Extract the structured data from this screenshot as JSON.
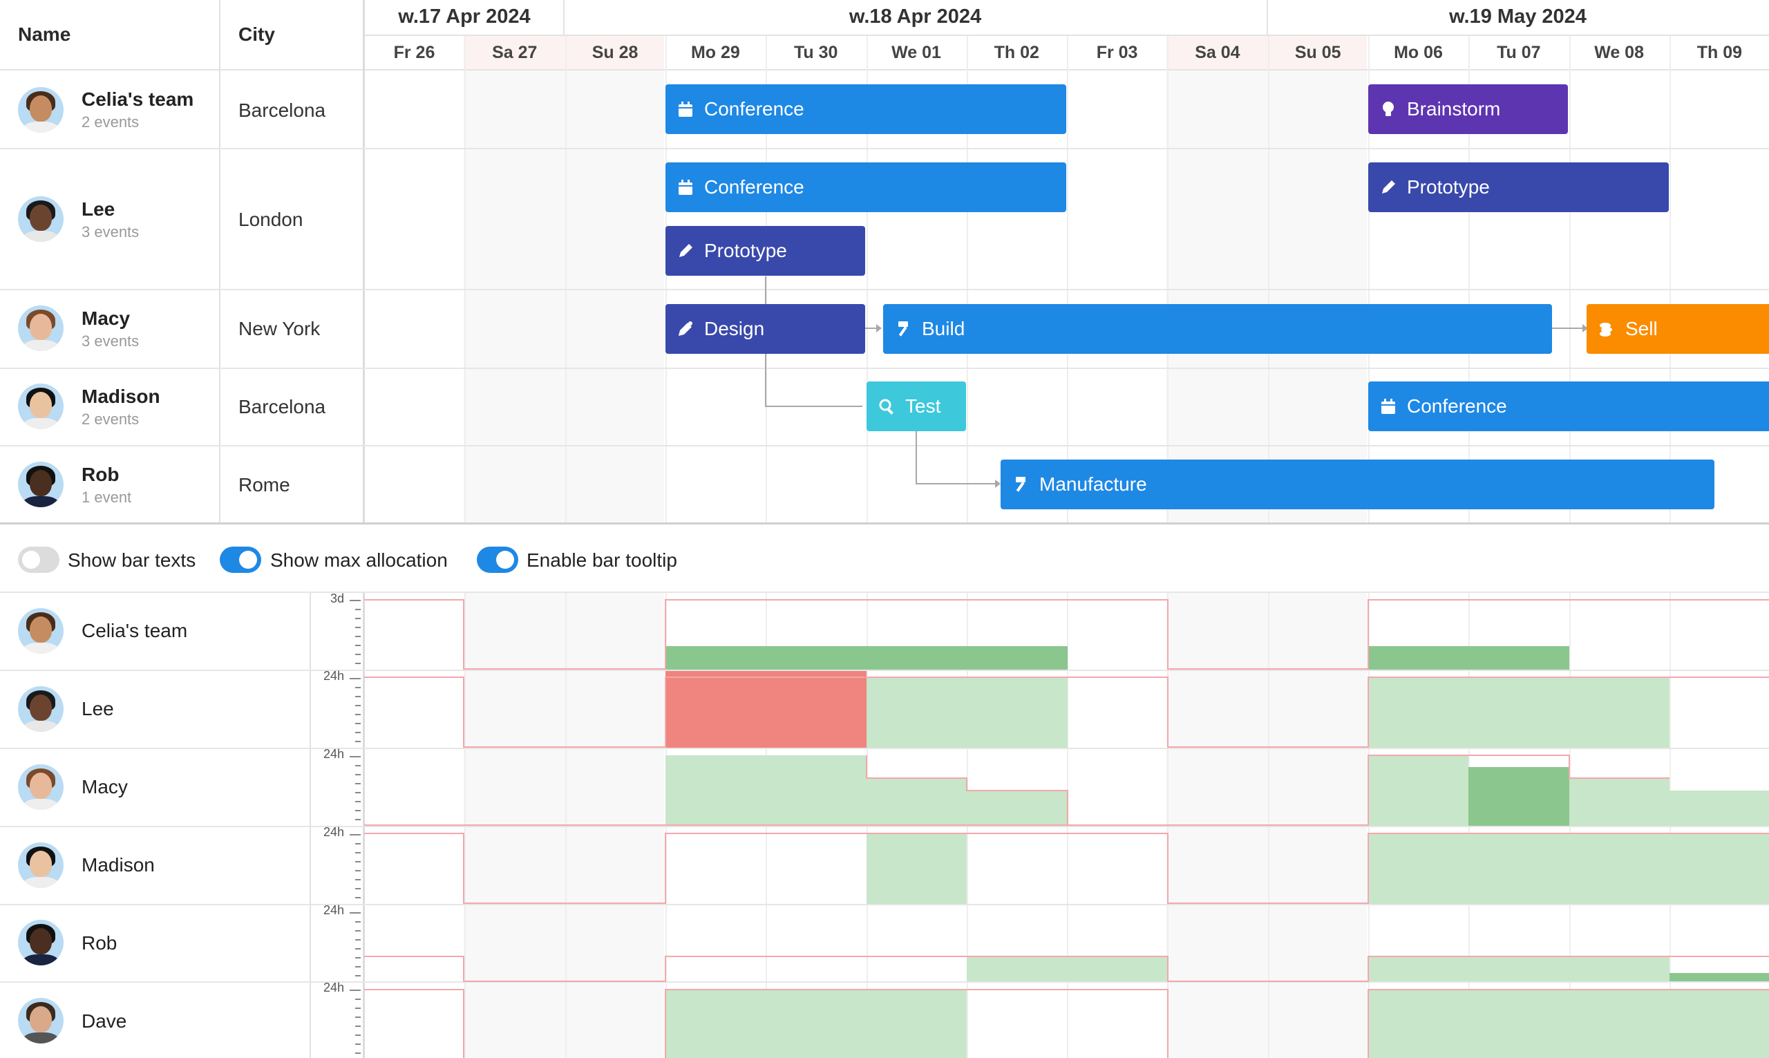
{
  "columns": {
    "name": "Name",
    "city": "City"
  },
  "weeks": [
    "w.17 Apr 2024",
    "w.18 Apr 2024",
    "w.19 May 2024"
  ],
  "days": [
    "Fr 26",
    "Sa 27",
    "Su 28",
    "Mo 29",
    "Tu 30",
    "We 01",
    "Th 02",
    "Fr 03",
    "Sa 04",
    "Su 05",
    "Mo 06",
    "Tu 07",
    "We 08",
    "Th 09"
  ],
  "resources": [
    {
      "name": "Celia's team",
      "events": "2 events",
      "city": "Barcelona"
    },
    {
      "name": "Lee",
      "events": "3 events",
      "city": "London"
    },
    {
      "name": "Macy",
      "events": "3 events",
      "city": "New York"
    },
    {
      "name": "Madison",
      "events": "2 events",
      "city": "Barcelona"
    },
    {
      "name": "Rob",
      "events": "1 event",
      "city": "Rome"
    }
  ],
  "events": [
    {
      "label": "Conference",
      "icon": "calendar-icon",
      "color": "#1e88e5"
    },
    {
      "label": "Brainstorm",
      "icon": "lightbulb-icon",
      "color": "#5e35b1"
    },
    {
      "label": "Conference",
      "icon": "calendar-icon",
      "color": "#1e88e5"
    },
    {
      "label": "Prototype",
      "icon": "pencil-icon",
      "color": "#3949ab"
    },
    {
      "label": "Prototype",
      "icon": "pencil-icon",
      "color": "#3949ab"
    },
    {
      "label": "Design",
      "icon": "pen-icon",
      "color": "#3949ab"
    },
    {
      "label": "Build",
      "icon": "hammer-icon",
      "color": "#1e88e5"
    },
    {
      "label": "Sell",
      "icon": "coins-icon",
      "color": "#fb8c00"
    },
    {
      "label": "Test",
      "icon": "search-icon",
      "color": "#3ec8dc"
    },
    {
      "label": "Conference",
      "icon": "calendar-icon",
      "color": "#1e88e5"
    },
    {
      "label": "Manufacture",
      "icon": "hammer-icon",
      "color": "#1e88e5"
    }
  ],
  "toolbar": {
    "show_bar_texts": "Show bar texts",
    "show_max_allocation": "Show max allocation",
    "enable_bar_tooltip": "Enable bar tooltip"
  },
  "toggles": {
    "show_bar_texts": false,
    "show_max_allocation": true,
    "enable_bar_tooltip": true
  },
  "histogram": {
    "rows": [
      "Celia's team",
      "Lee",
      "Macy",
      "Madison",
      "Rob",
      "Dave"
    ],
    "scale_labels": [
      "3d",
      "24h",
      "24h",
      "24h",
      "24h",
      "24h"
    ]
  },
  "colors": {
    "accent": "#1e88e5",
    "weekend_bg": "#f7f7f7",
    "weekend_header_bg": "#fdf1f1",
    "overallocated": "#f0847f",
    "allocated": "#c8e6c9",
    "allocated_strong": "#8bc68f",
    "max_line": "#f4a7ab"
  }
}
